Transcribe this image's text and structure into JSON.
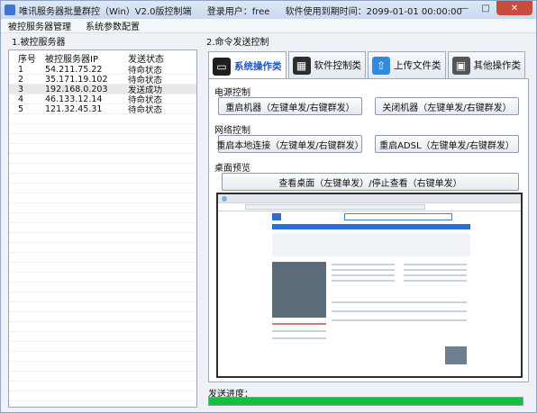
{
  "window": {
    "title": "唯讯服务器批量群控（Win）V2.0版控制端",
    "login_label": "登录用户：free",
    "expire_label": "软件使用到期时间：2099-01-01 00:00:00"
  },
  "menu": [
    "被控服务器管理",
    "系统参数配置"
  ],
  "left_panel": {
    "title": "1.被控服务器",
    "columns": [
      "序号",
      "被控服务器IP",
      "发送状态"
    ],
    "rows": [
      {
        "idx": "1",
        "ip": "54.211.75.22",
        "status": "待命状态"
      },
      {
        "idx": "2",
        "ip": "35.171.19.102",
        "status": "待命状态"
      },
      {
        "idx": "3",
        "ip": "192.168.0.203",
        "status": "发送成功"
      },
      {
        "idx": "4",
        "ip": "46.133.12.14",
        "status": "待命状态"
      },
      {
        "idx": "5",
        "ip": "121.32.45.31",
        "status": "待命状态"
      }
    ]
  },
  "right_panel": {
    "title": "2.命令发送控制",
    "tabs": [
      {
        "label": "系统操作类",
        "icon": "monitor-icon"
      },
      {
        "label": "软件控制类",
        "icon": "window-icon"
      },
      {
        "label": "上传文件类",
        "icon": "upload-icon"
      },
      {
        "label": "其他操作类",
        "icon": "screen-icon"
      }
    ],
    "power_section": "电源控制",
    "reboot_button": "重启机器（左键单发/右键群发）",
    "shutdown_button": "关闭机器（左键单发/右键群发）",
    "network_section": "网络控制",
    "reconnect_button": "重启本地连接（左键单发/右键群发）",
    "adsl_button": "重启ADSL（左键单发/右键群发）",
    "desktop_section": "桌面预览",
    "view_desktop_button": "查看桌面（左键单发）/停止查看（右键单发）",
    "progress_label": "发送进度：",
    "progress_value": 1.0
  },
  "colors": {
    "progress": "#12c03a",
    "active_tab_text": "#1a56c4",
    "close_button": "#c94c3f"
  }
}
